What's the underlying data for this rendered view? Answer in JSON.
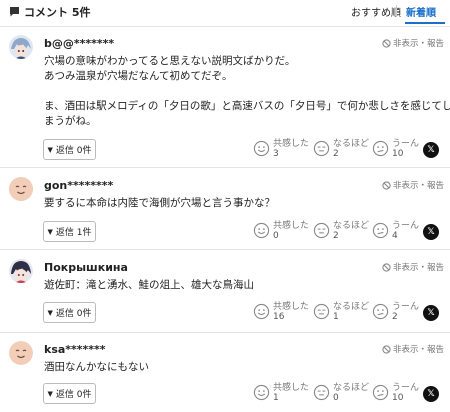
{
  "header": {
    "title": "コメント 5件",
    "sort_recommended": "おすすめ順",
    "sort_newest": "新着順",
    "title_icon": "comment-icon"
  },
  "actions": {
    "hide_report": "非表示・報告"
  },
  "reactions": {
    "empathy_label": "共感した",
    "insight_label": "なるほど",
    "hmm_label": "うーん"
  },
  "share_icon": "x-logo-icon",
  "comments": [
    {
      "username": "b@@*******",
      "avatar": "anime-character-avatar",
      "text_lines": [
        "穴場の意味がわかってると思えない説明文ばかりだ。",
        "あつみ温泉が穴場だなんて初めてだぞ。",
        "",
        "ま、酒田は駅メロディの「夕日の歌」と高速バスの「夕日号」で何か悲しさを感じてし",
        "まうがね。"
      ],
      "reply_label": "返信 0件",
      "empathy": "3",
      "insight": "2",
      "hmm": "10"
    },
    {
      "username": "gon********",
      "avatar": "default-face-avatar",
      "text_lines": [
        "要するに本命は内陸で海側が穴場と言う事かな？"
      ],
      "reply_label": "返信 1件",
      "empathy": "0",
      "insight": "2",
      "hmm": "4"
    },
    {
      "username": "Покрышкина",
      "avatar": "anime-character-avatar",
      "text_lines": [
        "遊佐町：滝と湧水、鮭の俎上、雄大な鳥海山"
      ],
      "reply_label": "返信 0件",
      "empathy": "16",
      "insight": "1",
      "hmm": "2"
    },
    {
      "username": "ksa*******",
      "avatar": "default-face-avatar",
      "text_lines": [
        "酒田なんかなにもない"
      ],
      "reply_label": "返信 0件",
      "empathy": "1",
      "insight": "0",
      "hmm": "10"
    }
  ],
  "colors": {
    "accent": "#1a6fc9",
    "muted": "#777777",
    "border": "#e4e4e4"
  }
}
